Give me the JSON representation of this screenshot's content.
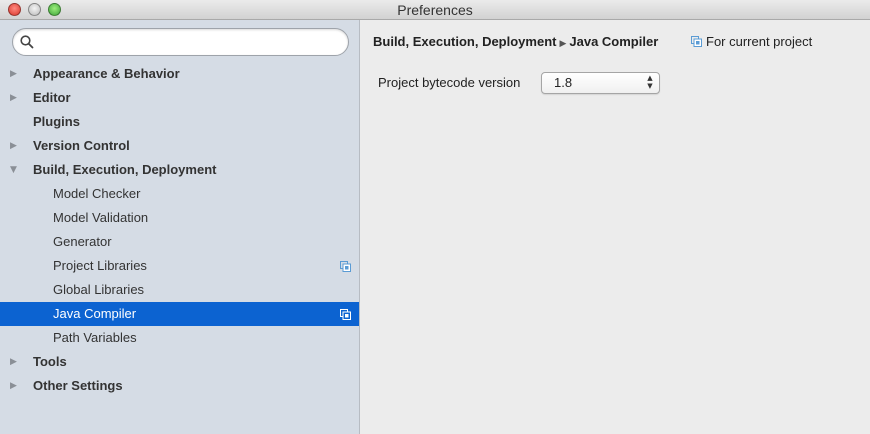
{
  "window": {
    "title": "Preferences"
  },
  "sidebar": {
    "search": {
      "value": "",
      "placeholder": ""
    },
    "items": [
      {
        "label": "Appearance & Behavior",
        "level": 0,
        "expander": "collapsed"
      },
      {
        "label": "Editor",
        "level": 0,
        "expander": "collapsed"
      },
      {
        "label": "Plugins",
        "level": 0,
        "expander": "none"
      },
      {
        "label": "Version Control",
        "level": 0,
        "expander": "collapsed"
      },
      {
        "label": "Build, Execution, Deployment",
        "level": 0,
        "expander": "expanded"
      },
      {
        "label": "Model Checker",
        "level": 1
      },
      {
        "label": "Model Validation",
        "level": 1
      },
      {
        "label": "Generator",
        "level": 1
      },
      {
        "label": "Project Libraries",
        "level": 1,
        "project_icon": true
      },
      {
        "label": "Global Libraries",
        "level": 1
      },
      {
        "label": "Java Compiler",
        "level": 1,
        "project_icon": true,
        "selected": true
      },
      {
        "label": "Path Variables",
        "level": 1
      },
      {
        "label": "Tools",
        "level": 0,
        "expander": "collapsed"
      },
      {
        "label": "Other Settings",
        "level": 0,
        "expander": "collapsed"
      }
    ]
  },
  "main": {
    "breadcrumb": {
      "parent": "Build, Execution, Deployment",
      "current": "Java Compiler"
    },
    "scope_label": "For current project",
    "bytecode": {
      "label": "Project bytecode version",
      "value": "1.8"
    }
  },
  "colors": {
    "sidebar_bg": "#d5dce5",
    "selection": "#0c63d1",
    "panel_bg": "#ececec",
    "project_icon": "#5a9bd4"
  },
  "icons": {
    "search": "search-icon",
    "project_scope": "project-scope-icon",
    "collapsed": "triangle-right-icon",
    "expanded": "triangle-down-icon"
  }
}
